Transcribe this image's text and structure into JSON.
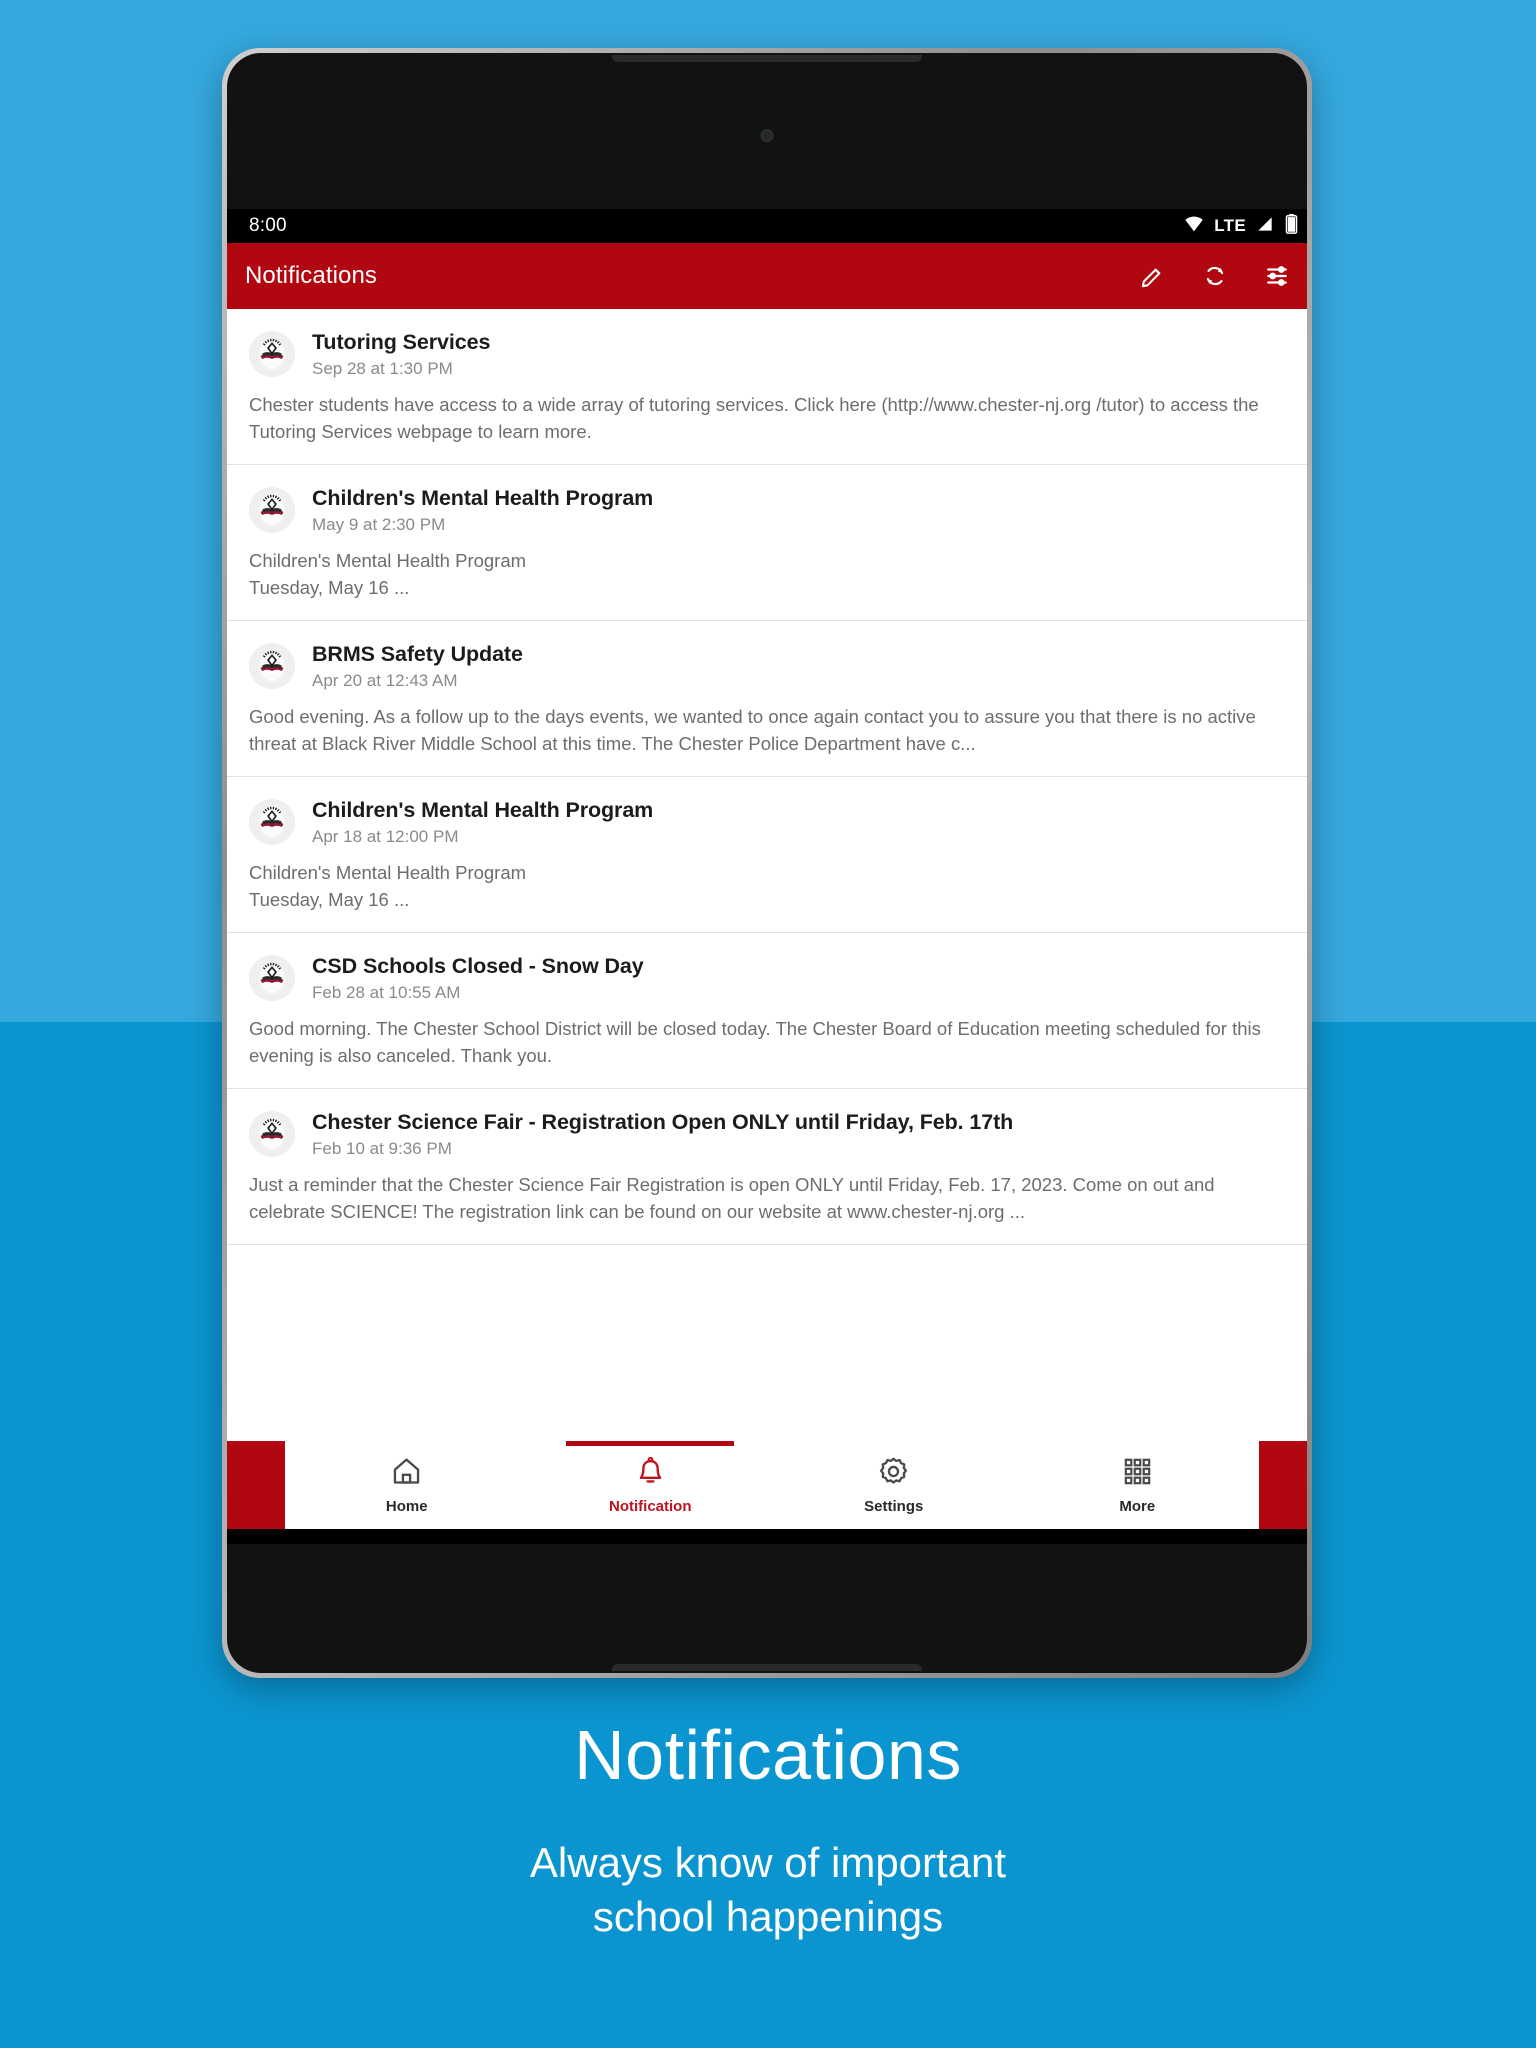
{
  "background": {
    "top_color": "#35a8de",
    "bottom_color": "#0b95d0"
  },
  "status_bar": {
    "clock": "8:00",
    "network_label": "LTE",
    "icons": [
      "wifi-icon",
      "signal-icon",
      "battery-icon"
    ]
  },
  "app_bar": {
    "title": "Notifications",
    "accent_color": "#b00710",
    "actions": [
      {
        "name": "edit-icon",
        "label": "Edit"
      },
      {
        "name": "refresh-icon",
        "label": "Refresh"
      },
      {
        "name": "filter-icon",
        "label": "Filter"
      }
    ]
  },
  "notifications": [
    {
      "title": "Tutoring Services",
      "time": "Sep 28 at 1:30 PM",
      "body": "Chester students have access to a wide array of tutoring services. Click here (http://www.chester-nj.org /tutor) to access the Tutoring Services webpage to learn more."
    },
    {
      "title": "Children's Mental Health Program",
      "time": "May 9 at 2:30 PM",
      "body": "Children's Mental Health Program\nTuesday, May 16 ..."
    },
    {
      "title": "BRMS Safety Update",
      "time": "Apr 20 at 12:43 AM",
      "body": "Good evening.  As a follow up to the days events, we wanted to once again contact you to assure you that there is no active threat at Black River Middle School at this time. The Chester Police Department have c..."
    },
    {
      "title": "Children's Mental Health Program",
      "time": "Apr 18 at 12:00 PM",
      "body": "Children's Mental Health Program\nTuesday, May 16 ..."
    },
    {
      "title": "CSD Schools Closed - Snow Day",
      "time": "Feb 28 at 10:55 AM",
      "body": "Good morning.  The Chester School District will be closed today.  The Chester Board of Education meeting scheduled for this evening is also canceled. Thank you."
    },
    {
      "title": "Chester Science Fair - Registration Open ONLY until Friday, Feb. 17th",
      "time": "Feb 10 at 9:36 PM",
      "body": "Just a reminder that the Chester Science Fair Registration is open ONLY until Friday, Feb. 17, 2023.  Come on out and celebrate SCIENCE!  The registration link can be found on our website at www.chester-nj.org ..."
    }
  ],
  "bottom_nav": {
    "active_color": "#c1121f",
    "items": [
      {
        "label": "Home",
        "icon": "home-icon",
        "active": false
      },
      {
        "label": "Notification",
        "icon": "bell-icon",
        "active": true
      },
      {
        "label": "Settings",
        "icon": "gear-icon",
        "active": false
      },
      {
        "label": "More",
        "icon": "grid-icon",
        "active": false
      }
    ]
  },
  "system_nav": {
    "buttons": [
      "back-icon",
      "home-icon",
      "recents-icon"
    ]
  },
  "caption": {
    "title": "Notifications",
    "subtitle": "Always know of important\nschool happenings"
  }
}
